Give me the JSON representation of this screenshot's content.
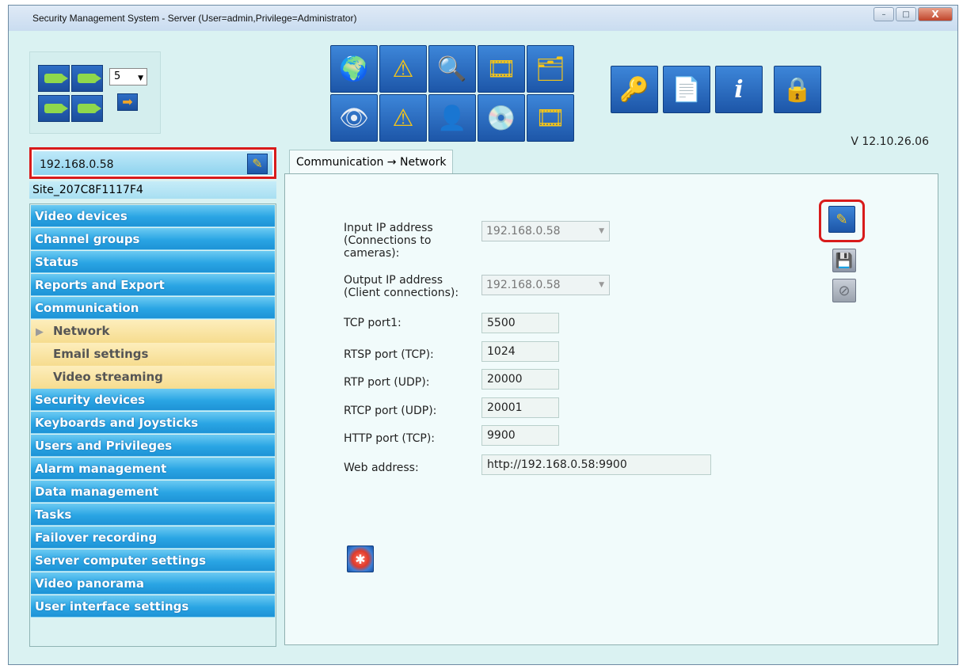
{
  "window": {
    "title": "Security Management System - Server (User=admin,Privilege=Administrator)",
    "minimize": "–",
    "maximize": "□",
    "close": "X"
  },
  "camera_panel": {
    "layout_select_value": "5"
  },
  "toolbar": {
    "icons": [
      "globe-icon",
      "warning-icon",
      "search-icon",
      "video-star-icon",
      "folders-icon",
      "eye-icon",
      "alarm-warning-icon",
      "user-icon",
      "disc-icon",
      "video-export-icon",
      "key-icon",
      "document-help-icon",
      "info-icon",
      "lock-icon"
    ]
  },
  "version": "V 12.10.26.06",
  "server": {
    "ip": "192.168.0.58",
    "site": "Site_207C8F1117F4"
  },
  "nav": {
    "items": [
      {
        "label": "Video devices"
      },
      {
        "label": "Channel groups"
      },
      {
        "label": "Status"
      },
      {
        "label": "Reports and Export"
      },
      {
        "label": "Communication"
      },
      {
        "label": "Network",
        "sub": true,
        "active": true
      },
      {
        "label": "Email settings",
        "sub": true
      },
      {
        "label": "Video streaming",
        "sub": true
      },
      {
        "label": "Security devices"
      },
      {
        "label": "Keyboards and Joysticks"
      },
      {
        "label": "Users and Privileges"
      },
      {
        "label": "Alarm management"
      },
      {
        "label": "Data management"
      },
      {
        "label": "Tasks"
      },
      {
        "label": "Failover recording"
      },
      {
        "label": "Server computer settings"
      },
      {
        "label": "Video panorama"
      },
      {
        "label": "User interface settings"
      }
    ]
  },
  "tab": {
    "label": "Communication → Network"
  },
  "form": {
    "input_ip_label_1": "Input IP address",
    "input_ip_label_2": "(Connections to",
    "input_ip_label_3": "cameras):",
    "input_ip_value": "192.168.0.58",
    "output_ip_label_1": "Output IP address",
    "output_ip_label_2": "(Client connections):",
    "output_ip_value": "192.168.0.58",
    "tcp_port1_label": "TCP port1:",
    "tcp_port1_value": "5500",
    "rtsp_label": "RTSP port (TCP):",
    "rtsp_value": "1024",
    "rtp_label": "RTP port (UDP):",
    "rtp_value": "20000",
    "rtcp_label": "RTCP port (UDP):",
    "rtcp_value": "20001",
    "http_label": "HTTP port (TCP):",
    "http_value": "9900",
    "web_label": "Web address:",
    "web_value": "http://192.168.0.58:9900"
  },
  "colors": {
    "highlight": "#d81b1b",
    "nav_blue": "#2aa5e4",
    "nav_sub": "#f6dc8f"
  }
}
